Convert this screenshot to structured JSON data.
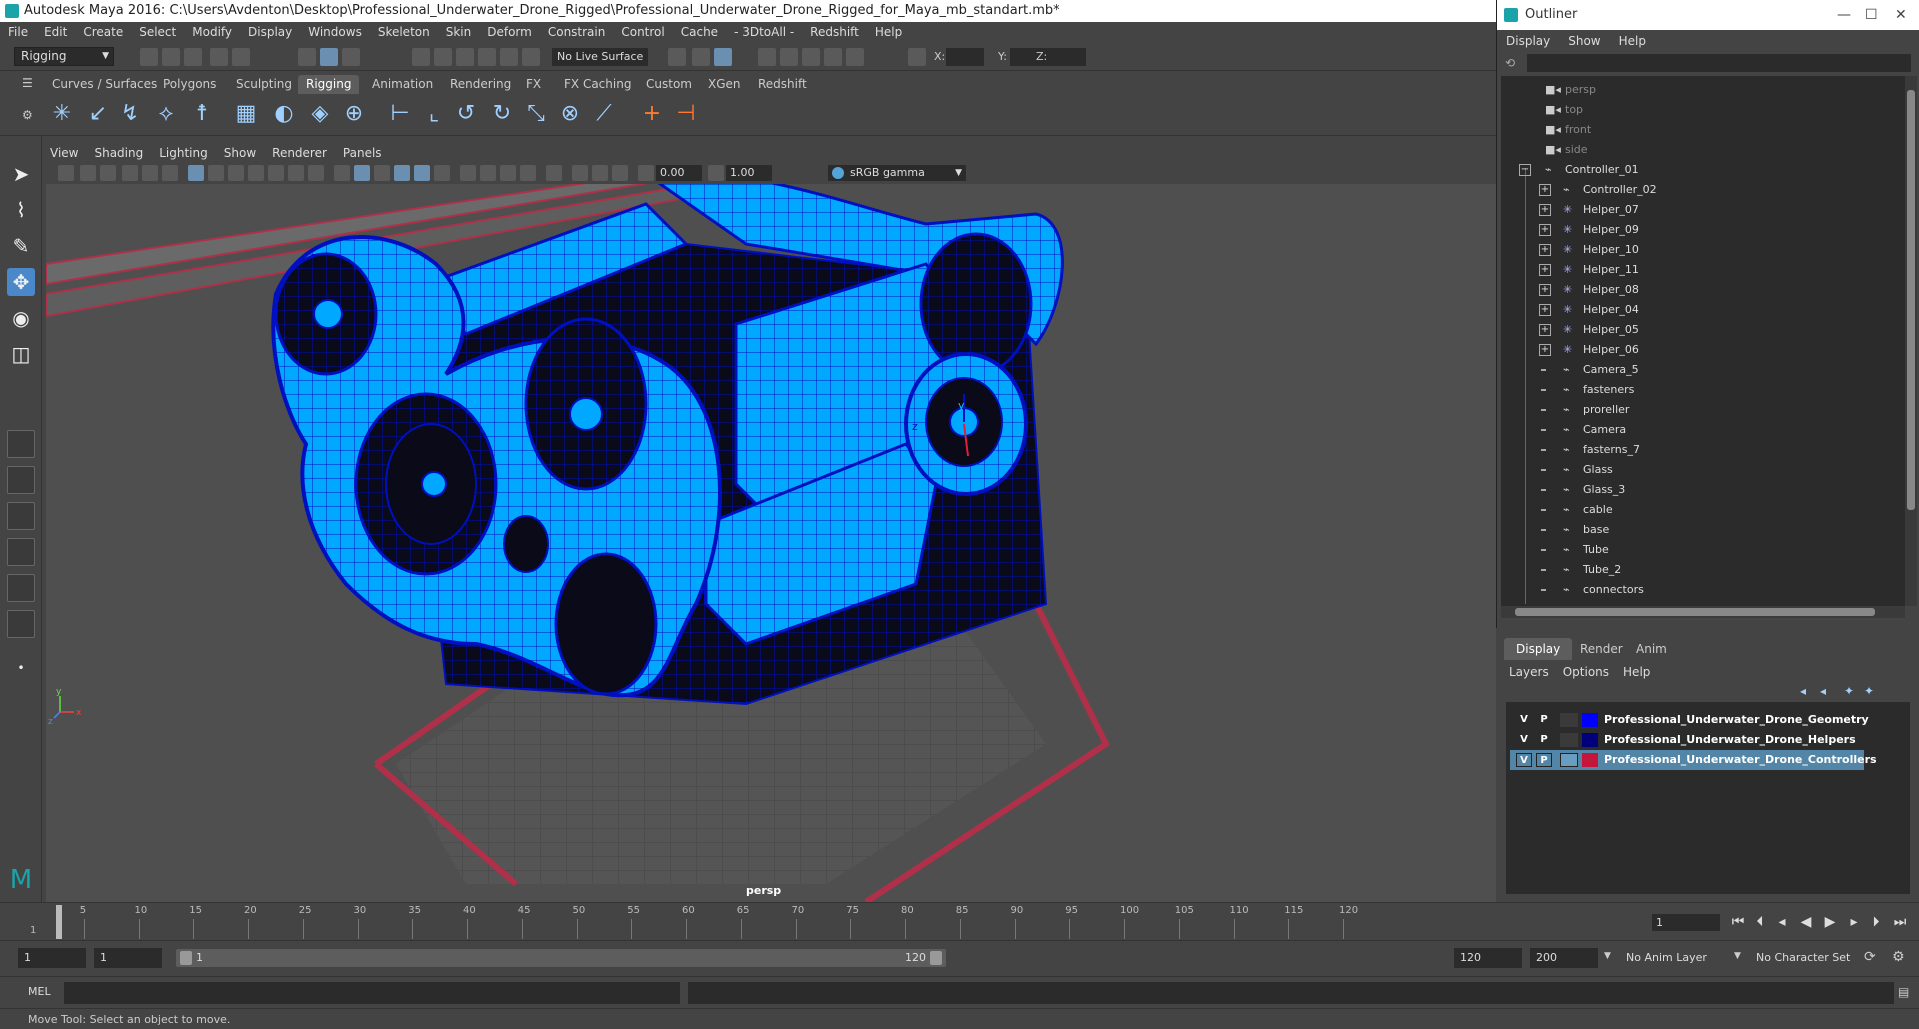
{
  "title": "Autodesk Maya 2016: C:\\Users\\Avdenton\\Desktop\\Professional_Underwater_Drone_Rigged\\Professional_Underwater_Drone_Rigged_for_Maya_mb_standart.mb*",
  "menubar": [
    "File",
    "Edit",
    "Create",
    "Select",
    "Modify",
    "Display",
    "Windows",
    "Skeleton",
    "Skin",
    "Deform",
    "Constrain",
    "Control",
    "Cache",
    "- 3DtoAll -",
    "Redshift",
    "Help"
  ],
  "statusline": {
    "mode": "Rigging",
    "live_surface": "No Live Surface",
    "x_label": "X:",
    "y_label": "Y:",
    "z_label": "Z:"
  },
  "shelf": {
    "tabs": [
      "Curves / Surfaces",
      "Polygons",
      "Sculpting",
      "Rigging",
      "Animation",
      "Rendering",
      "FX",
      "FX Caching",
      "Custom",
      "XGen",
      "Redshift"
    ],
    "active": "Rigging"
  },
  "viewport": {
    "menu": [
      "View",
      "Shading",
      "Lighting",
      "Show",
      "Renderer",
      "Panels"
    ],
    "exposure": "0.00",
    "gamma_value": "1.00",
    "color_space": "sRGB gamma",
    "camera": "persp",
    "axis_x": "x",
    "axis_y": "y",
    "axis_z": "z"
  },
  "outliner": {
    "title": "Outliner",
    "menu": [
      "Display",
      "Show",
      "Help"
    ],
    "cameras": [
      "persp",
      "top",
      "front",
      "side"
    ],
    "root": "Controller_01",
    "children_expand": [
      "Controller_02",
      "Helper_07",
      "Helper_09",
      "Helper_10",
      "Helper_11",
      "Helper_08",
      "Helper_04",
      "Helper_05",
      "Helper_06"
    ],
    "children_leaf": [
      "Camera_5",
      "fasteners",
      "proreller",
      "Camera",
      "fasterns_7",
      "Glass",
      "Glass_3",
      "cable",
      "base",
      "Tube",
      "Tube_2",
      "connectors"
    ]
  },
  "layers": {
    "tabs": [
      "Display",
      "Render",
      "Anim"
    ],
    "active_tab": "Display",
    "menu": [
      "Layers",
      "Options",
      "Help"
    ],
    "items": [
      {
        "v": "V",
        "p": "P",
        "name": "Professional_Underwater_Drone_Geometry",
        "color": "#0000ff",
        "selected": false
      },
      {
        "v": "V",
        "p": "P",
        "name": "Professional_Underwater_Drone_Helpers",
        "color": "#00007a",
        "selected": false
      },
      {
        "v": "V",
        "p": "P",
        "name": "Professional_Underwater_Drone_Controllers",
        "color": "#c4153a",
        "selected": true
      }
    ]
  },
  "timeline": {
    "ticks": [
      "5",
      "10",
      "15",
      "20",
      "25",
      "30",
      "35",
      "40",
      "45",
      "50",
      "55",
      "60",
      "65",
      "70",
      "75",
      "80",
      "85",
      "90",
      "95",
      "100",
      "105",
      "110",
      "115",
      "120"
    ],
    "start_tick": "1",
    "current_frame": "1"
  },
  "range": {
    "start": "1",
    "anim_start": "1",
    "range_start": "1",
    "range_end": "120",
    "anim_end": "120",
    "end": "200",
    "anim_layer": "No Anim Layer",
    "character_set": "No Character Set"
  },
  "mel": {
    "label": "MEL"
  },
  "help_line": "Move Tool: Select an object to move."
}
